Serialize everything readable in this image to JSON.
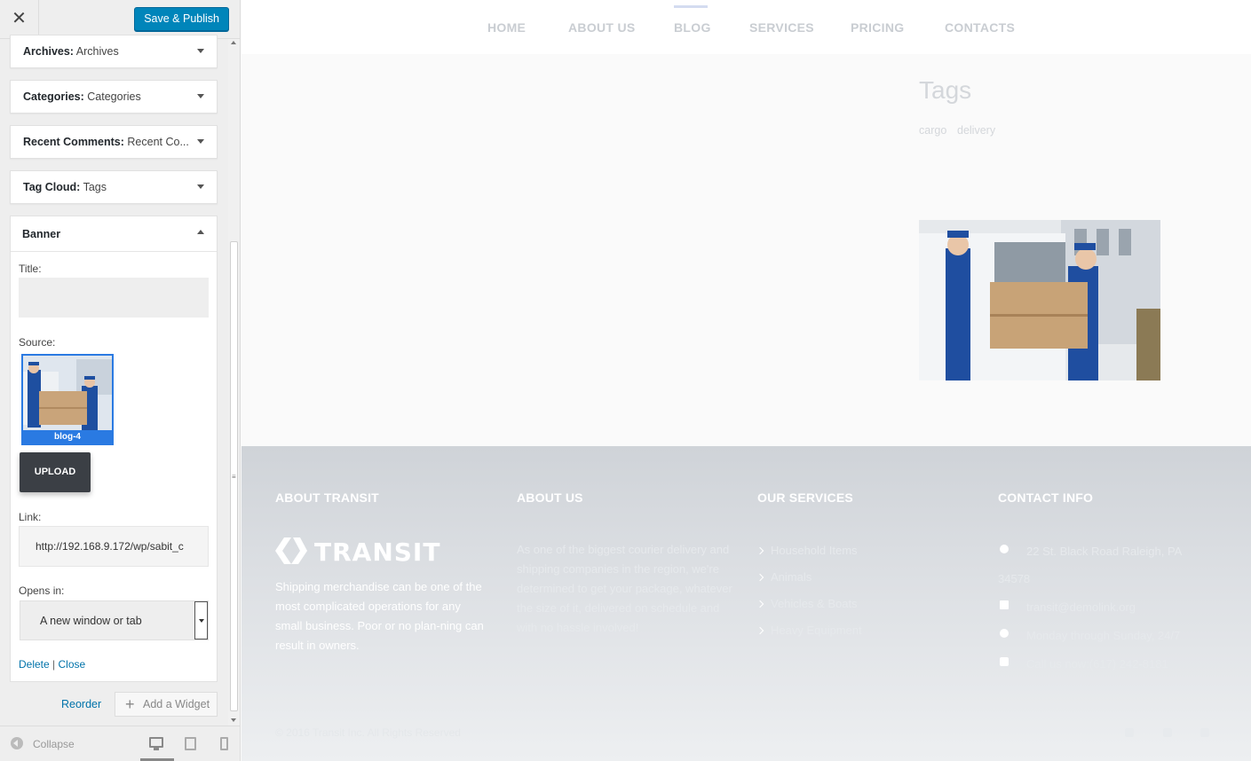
{
  "panel": {
    "close_label": "✕",
    "save_publish": "Save & Publish",
    "widgets": [
      {
        "name": "Archives:",
        "subtitle": "Archives"
      },
      {
        "name": "Categories:",
        "subtitle": "Categories"
      },
      {
        "name": "Recent Comments:",
        "subtitle": "Recent Co..."
      },
      {
        "name": "Tag Cloud:",
        "subtitle": "Tags"
      }
    ],
    "banner": {
      "title": "Banner",
      "title_label": "Title:",
      "title_value": "",
      "source_label": "Source:",
      "source_image": "blog-4",
      "upload_label": "UPLOAD",
      "link_label": "Link:",
      "link_value": "http://192.168.9.172/wp/sabit_c",
      "opens_label": "Opens in:",
      "opens_value": "A new window or tab",
      "delete_label": "Delete",
      "separator": "|",
      "close_label": "Close"
    },
    "reorder_label": "Reorder",
    "add_widget_label": "Add a Widget",
    "collapse_label": "Collapse"
  },
  "site": {
    "nav": [
      "HOME",
      "ABOUT US",
      "BLOG",
      "SERVICES",
      "PRICING",
      "CONTACTS"
    ],
    "active_nav": "BLOG",
    "tags_title": "Tags",
    "tags": [
      "cargo",
      "delivery"
    ],
    "footer": {
      "col1_title": "ABOUT TRANSIT",
      "logo_text": "TRANSIT",
      "col1_text": "Shipping merchandise can be one of the most complicated operations for any small business. Poor or no plan-ning can result in owners.",
      "col2_title": "ABOUT US",
      "col2_text": "As one of the biggest courier delivery and shipping companies in the region, we're determined to get your package, whatever the size of it, delivered on schedule and with no hassle involved!",
      "col3_title": "OUR SERVICES",
      "services": [
        "Household Items",
        "Animals",
        "Vehicles & Boats",
        "Heavy Equipment"
      ],
      "col4_title": "CONTACT INFO",
      "address_line1": "22 St. Black Road Raleigh, PA",
      "address_line2": "34578",
      "email": "transit@demolink.org",
      "hours": "Monday through Sunday, 24/7",
      "phone": "Call us now:(617) 242-8181",
      "copyright": "© 2016 Transit Inc. All Rights Reserved"
    }
  },
  "colors": {
    "accent": "#0085ba",
    "link": "#0073aa",
    "upload_bg": "#3b3f45",
    "nav_text": "#c9cdd2"
  }
}
